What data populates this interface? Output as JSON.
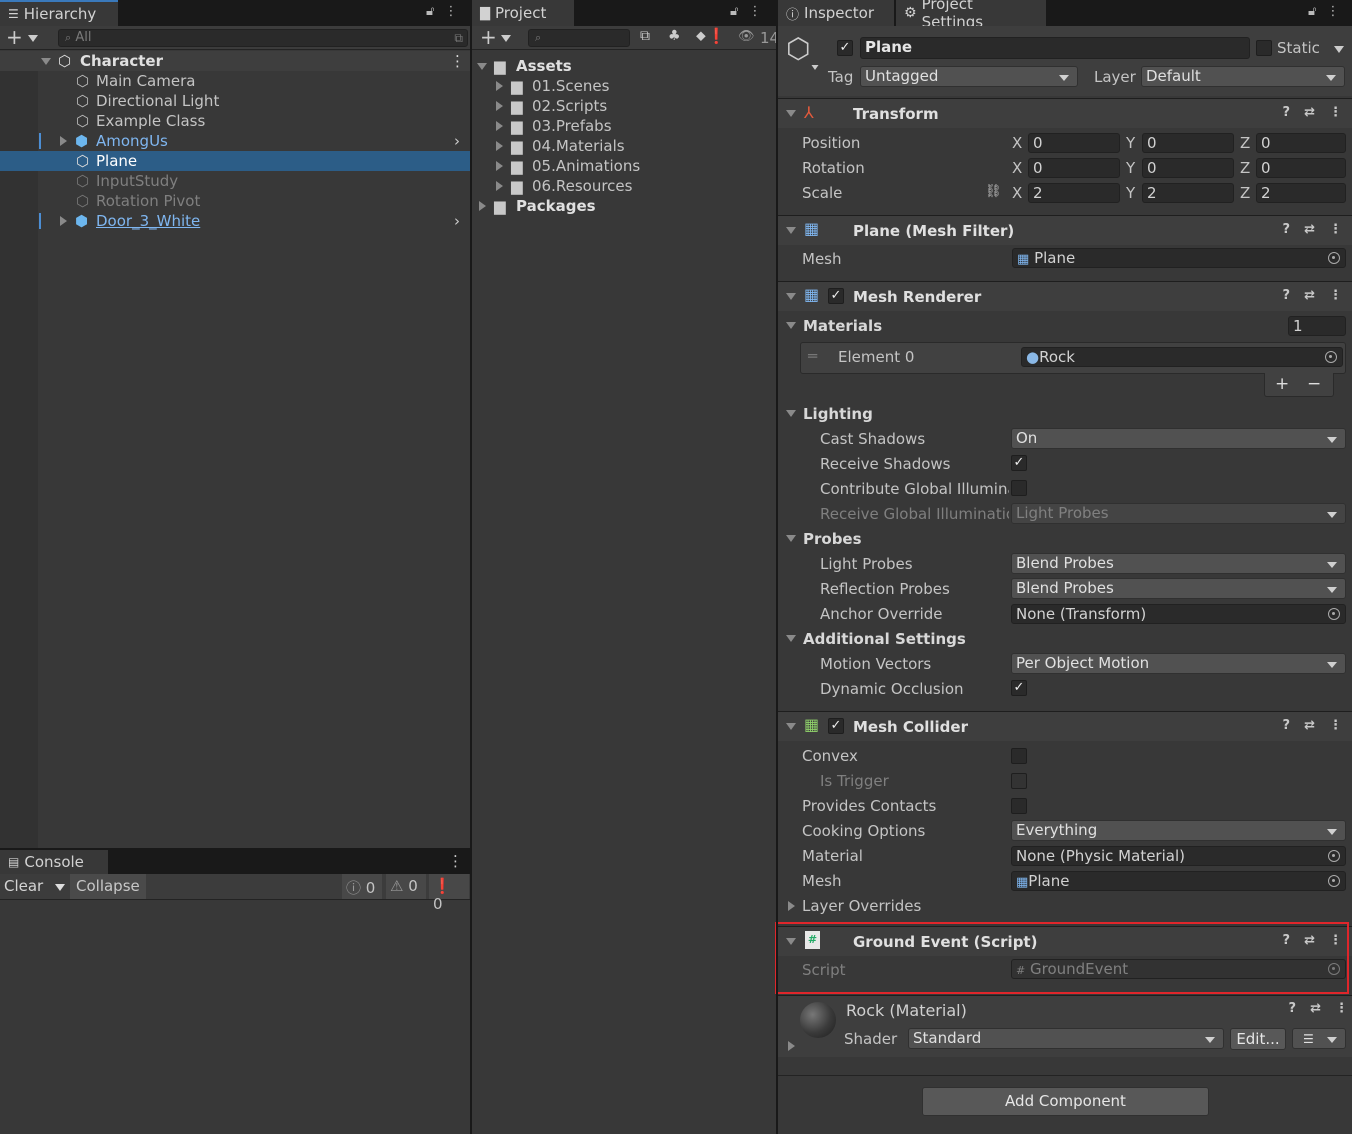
{
  "hierarchy": {
    "tab": "Hierarchy",
    "search_placeholder": "All",
    "scene": "Character",
    "items": [
      {
        "label": "Main Camera"
      },
      {
        "label": "Directional Light"
      },
      {
        "label": "Example Class"
      },
      {
        "label": "AmongUs"
      },
      {
        "label": "Plane"
      },
      {
        "label": "InputStudy"
      },
      {
        "label": "Rotation Pivot"
      },
      {
        "label": "Door_3_White"
      }
    ]
  },
  "console": {
    "tab": "Console",
    "clear": "Clear",
    "collapse": "Collapse",
    "log_count": "0",
    "warn_count": "0",
    "error_count": "0"
  },
  "project": {
    "tab": "Project",
    "hidden_count": "14",
    "assets": "Assets",
    "folders": [
      {
        "label": "01.Scenes"
      },
      {
        "label": "02.Scripts"
      },
      {
        "label": "03.Prefabs"
      },
      {
        "label": "04.Materials"
      },
      {
        "label": "05.Animations"
      },
      {
        "label": "06.Resources"
      }
    ],
    "packages": "Packages"
  },
  "inspector": {
    "tab_inspector": "Inspector",
    "tab_settings": "Project Settings",
    "object_name": "Plane",
    "static_label": "Static",
    "tag_label": "Tag",
    "tag_value": "Untagged",
    "layer_label": "Layer",
    "layer_value": "Default",
    "transform": {
      "title": "Transform",
      "position": "Position",
      "rotation": "Rotation",
      "scale": "Scale",
      "x": "X",
      "y": "Y",
      "z": "Z",
      "pos": [
        "0",
        "0",
        "0"
      ],
      "rot": [
        "0",
        "0",
        "0"
      ],
      "scl": [
        "2",
        "2",
        "2"
      ]
    },
    "mesh_filter": {
      "title": "Plane (Mesh Filter)",
      "mesh_label": "Mesh",
      "mesh_value": "Plane"
    },
    "mesh_renderer": {
      "title": "Mesh Renderer",
      "materials": "Materials",
      "materials_count": "1",
      "element0": "Element 0",
      "element0_value": "Rock",
      "plus": "+",
      "minus": "−",
      "lighting": "Lighting",
      "cast_shadows": "Cast Shadows",
      "cast_shadows_value": "On",
      "receive_shadows": "Receive Shadows",
      "contribute_gi": "Contribute Global Illuminat",
      "receive_gi": "Receive Global Illuminatio",
      "receive_gi_value": "Light Probes",
      "probes": "Probes",
      "light_probes": "Light Probes",
      "light_probes_value": "Blend Probes",
      "reflection_probes": "Reflection Probes",
      "reflection_probes_value": "Blend Probes",
      "anchor_override": "Anchor Override",
      "anchor_override_value": "None (Transform)",
      "additional": "Additional Settings",
      "motion_vectors": "Motion Vectors",
      "motion_vectors_value": "Per Object Motion",
      "dynamic_occlusion": "Dynamic Occlusion"
    },
    "mesh_collider": {
      "title": "Mesh Collider",
      "convex": "Convex",
      "is_trigger": "Is Trigger",
      "provides_contacts": "Provides Contacts",
      "cooking_options": "Cooking Options",
      "cooking_value": "Everything",
      "material": "Material",
      "material_value": "None (Physic Material)",
      "mesh": "Mesh",
      "mesh_value": "Plane",
      "layer_overrides": "Layer Overrides"
    },
    "ground_event": {
      "title": "Ground Event (Script)",
      "script_label": "Script",
      "script_value": "GroundEvent"
    },
    "material": {
      "title": "Rock (Material)",
      "shader_label": "Shader",
      "shader_value": "Standard",
      "edit": "Edit..."
    },
    "add_component": "Add Component"
  },
  "colors": {
    "highlight": "#e0262b",
    "selection": "#2c5d87",
    "prefab": "#7fb6f0"
  }
}
